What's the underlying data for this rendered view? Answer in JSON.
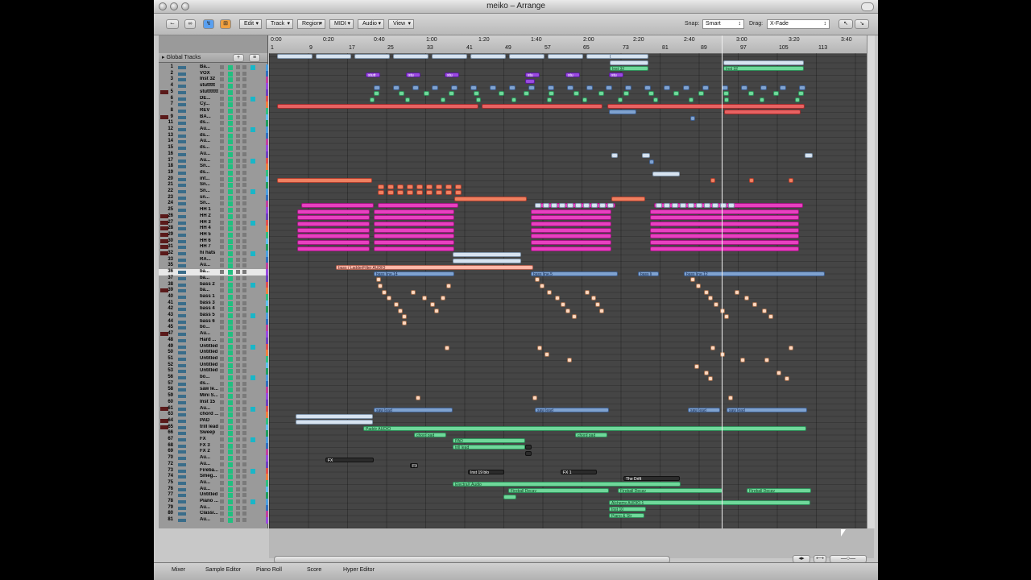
{
  "window": {
    "title": "meiko – Arrange"
  },
  "toolbar": {
    "menus": [
      "Edit",
      "Track",
      "Region",
      "MIDI",
      "Audio",
      "View"
    ],
    "snap_label": "Snap:",
    "snap_value": "Smart",
    "drag_label": "Drag:",
    "drag_value": "X-Fade"
  },
  "global_tracks_label": "Global Tracks",
  "ruler": {
    "times": [
      "0:00",
      "0:20",
      "0:40",
      "1:00",
      "1:20",
      "1:40",
      "2:00",
      "2:20",
      "2:40",
      "3:00",
      "3:20",
      "3:40"
    ],
    "bars": [
      "1",
      "9",
      "17",
      "25",
      "33",
      "41",
      "49",
      "57",
      "65",
      "73",
      "81",
      "89",
      "97",
      "105",
      "113"
    ]
  },
  "tracks": [
    {
      "n": "1",
      "name": "Ba..."
    },
    {
      "n": "2",
      "name": "VOX"
    },
    {
      "n": "3",
      "name": "Inst 32"
    },
    {
      "n": "4",
      "name": "stuttttt"
    },
    {
      "n": "5",
      "name": "stuttttttt"
    },
    {
      "n": "6",
      "name": "DE..."
    },
    {
      "n": "7",
      "name": "Cy..."
    },
    {
      "n": "8",
      "name": "REV"
    },
    {
      "n": "9",
      "name": "BA..."
    },
    {
      "n": "11",
      "name": "ds..."
    },
    {
      "n": "12",
      "name": "Au..."
    },
    {
      "n": "13",
      "name": "ds..."
    },
    {
      "n": "14",
      "name": "Au..."
    },
    {
      "n": "15",
      "name": "ds..."
    },
    {
      "n": "16",
      "name": "Au..."
    },
    {
      "n": "17",
      "name": "Au..."
    },
    {
      "n": "18",
      "name": "Sn..."
    },
    {
      "n": "19",
      "name": "ds..."
    },
    {
      "n": "20",
      "name": "int..."
    },
    {
      "n": "21",
      "name": "Sn..."
    },
    {
      "n": "22",
      "name": "Sn..."
    },
    {
      "n": "23",
      "name": "sn..."
    },
    {
      "n": "24",
      "name": "Sn..."
    },
    {
      "n": "25",
      "name": "HH 1"
    },
    {
      "n": "26",
      "name": "HH 2"
    },
    {
      "n": "27",
      "name": "HH 3"
    },
    {
      "n": "28",
      "name": "HH 4"
    },
    {
      "n": "29",
      "name": "HH 5"
    },
    {
      "n": "30",
      "name": "HH 6"
    },
    {
      "n": "31",
      "name": "HH 7"
    },
    {
      "n": "32",
      "name": "hi hats"
    },
    {
      "n": "33",
      "name": "RA..."
    },
    {
      "n": "35",
      "name": "Au..."
    },
    {
      "n": "36",
      "name": "ba..."
    },
    {
      "n": "37",
      "name": "ba..."
    },
    {
      "n": "38",
      "name": "bass 2"
    },
    {
      "n": "39",
      "name": "ba..."
    },
    {
      "n": "40",
      "name": "bass 1"
    },
    {
      "n": "41",
      "name": "bass 3"
    },
    {
      "n": "42",
      "name": "bass 4"
    },
    {
      "n": "43",
      "name": "bass 5"
    },
    {
      "n": "44",
      "name": "bass 6"
    },
    {
      "n": "45",
      "name": "bo..."
    },
    {
      "n": "47",
      "name": "Au..."
    },
    {
      "n": "48",
      "name": "Hard ..."
    },
    {
      "n": "49",
      "name": "Untitled"
    },
    {
      "n": "50",
      "name": "Untitled"
    },
    {
      "n": "51",
      "name": "Untitled"
    },
    {
      "n": "52",
      "name": "Untitled"
    },
    {
      "n": "53",
      "name": "Untitled"
    },
    {
      "n": "56",
      "name": "bo..."
    },
    {
      "n": "57",
      "name": "ds..."
    },
    {
      "n": "58",
      "name": "saw le..."
    },
    {
      "n": "59",
      "name": "Mini S..."
    },
    {
      "n": "60",
      "name": "Inst 15"
    },
    {
      "n": "61",
      "name": "Au..."
    },
    {
      "n": "63",
      "name": "chord ..."
    },
    {
      "n": "64",
      "name": "PAD"
    },
    {
      "n": "65",
      "name": "trill lead"
    },
    {
      "n": "66",
      "name": "Sweep"
    },
    {
      "n": "67",
      "name": "FX"
    },
    {
      "n": "68",
      "name": "FX 3"
    },
    {
      "n": "69",
      "name": "FX 2"
    },
    {
      "n": "70",
      "name": "Au..."
    },
    {
      "n": "72",
      "name": "Au..."
    },
    {
      "n": "73",
      "name": "Fireba..."
    },
    {
      "n": "74",
      "name": "Smeg..."
    },
    {
      "n": "75",
      "name": "Au..."
    },
    {
      "n": "76",
      "name": "Au..."
    },
    {
      "n": "77",
      "name": "Untitled"
    },
    {
      "n": "78",
      "name": "Piano ..."
    },
    {
      "n": "79",
      "name": "Au..."
    },
    {
      "n": "80",
      "name": "Classi..."
    },
    {
      "n": "81",
      "name": "Au..."
    }
  ],
  "region_labels": {
    "bass_ladder": "bass / LadderFilter AUDIO",
    "bass_line_14": "bass line.14",
    "bass_line_5": "bass line.5",
    "bass_line_12": "bass line.12",
    "bass_l": "bass li",
    "saw_lead": "saw lead",
    "paddy": "Paddy AUDIO",
    "chord_pad": "chord pad",
    "pad": "PAD",
    "trill_lead": "trill lead",
    "fx": "FX",
    "fx1": "FX 1",
    "inst19": "Inst 19 blo",
    "the_drift": "The Drift",
    "electrax": "ElectraX Audio",
    "fireball": "Fireball Decay",
    "alchemy": "Alchemy AUDIO.1",
    "inst10": "Inst 10",
    "piano": "Piano & Str",
    "inst32": "Inst 32",
    "stutt": "stutt",
    "str": "stu"
  },
  "bottom_tabs": [
    "Mixer",
    "Sample Editor",
    "Piano Roll",
    "Score",
    "Hyper Editor"
  ]
}
